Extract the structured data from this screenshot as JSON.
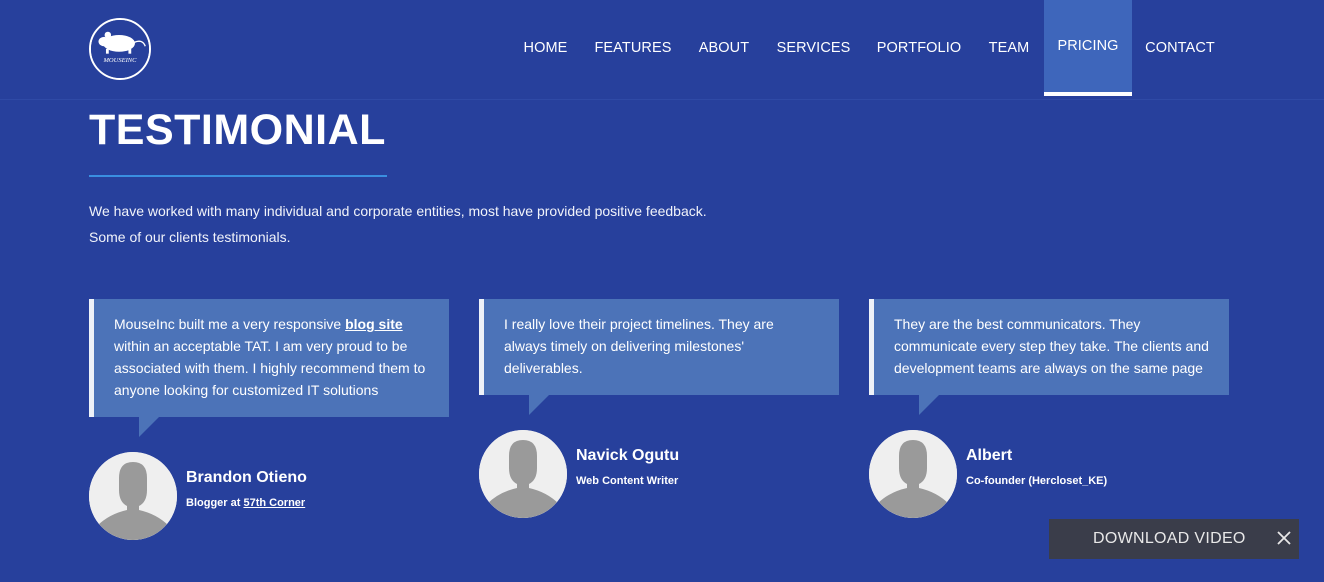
{
  "header": {
    "logo_text": "MOUSEINC",
    "nav": [
      {
        "label": "HOME",
        "active": false
      },
      {
        "label": "FEATURES",
        "active": false
      },
      {
        "label": "ABOUT",
        "active": false
      },
      {
        "label": "SERVICES",
        "active": false
      },
      {
        "label": "PORTFOLIO",
        "active": false
      },
      {
        "label": "TEAM",
        "active": false
      },
      {
        "label": "PRICING",
        "active": true
      },
      {
        "label": "CONTACT",
        "active": false
      }
    ]
  },
  "section": {
    "title": "TESTIMONIAL",
    "intro_line1": "We have worked with many individual and corporate entities, most have provided positive feedback.",
    "intro_line2": "Some of our clients testimonials."
  },
  "testimonials": [
    {
      "quote_before": "MouseInc built me a very responsive ",
      "quote_link": "blog site",
      "quote_after": " within an acceptable TAT. I am very proud to be associated with them. I highly recommend them to anyone looking for customized IT solutions",
      "name": "Brandon Otieno",
      "role_prefix": "Blogger at ",
      "role_link": "57th Corner"
    },
    {
      "quote_before": "I really love their project timelines. They are always timely on delivering milestones' deliverables.",
      "name": "Navick Ogutu",
      "role_prefix": "Web Content Writer"
    },
    {
      "quote_before": "They are the best communicators. They communicate every step they take. The clients and development teams are always on the same page",
      "name": "Albert",
      "role_prefix": "Co-founder (Hercloset_KE)"
    }
  ],
  "download_bar": {
    "label": "DOWNLOAD VIDEO",
    "close_icon": "close-icon"
  },
  "colors": {
    "background": "#27409c",
    "nav_active": "#3e66bb",
    "card": "#4c73b8",
    "accent_underline": "#3a8fe0",
    "download_bar": "#3a3d4a"
  }
}
